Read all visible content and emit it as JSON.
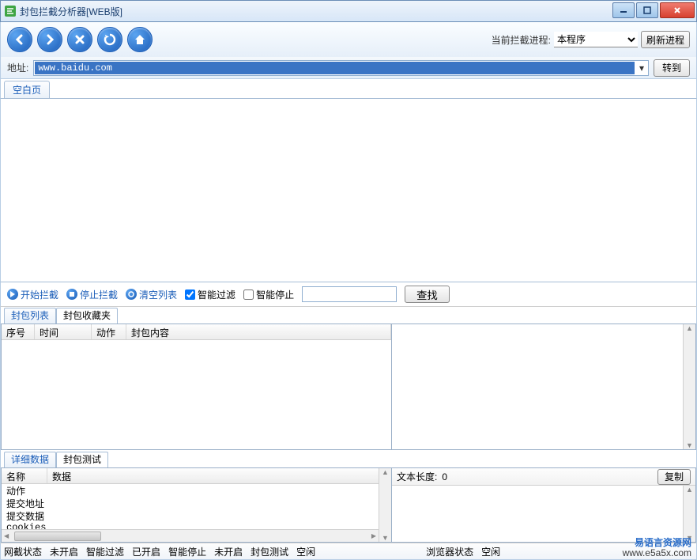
{
  "window": {
    "title": "封包拦截分析器[WEB版]"
  },
  "toolbar": {
    "process_label": "当前拦截进程:",
    "process_selected": "本程序",
    "refresh": "刷新进程"
  },
  "address": {
    "label": "地址:",
    "value": "www.baidu.com",
    "go": "转到"
  },
  "browser_tabs": [
    "空白页"
  ],
  "actions": {
    "start": "开始拦截",
    "stop": "停止拦截",
    "clear": "清空列表",
    "smart_filter": "智能过滤",
    "smart_stop": "智能停止",
    "search": "查找"
  },
  "action_checks": {
    "smart_filter": true,
    "smart_stop": false
  },
  "packet_tabs": [
    "封包列表",
    "封包收藏夹"
  ],
  "packet_columns": {
    "seq": "序号",
    "time": "时间",
    "action": "动作",
    "content": "封包内容"
  },
  "detail_tabs": [
    "详细数据",
    "封包测试"
  ],
  "detail_columns": {
    "name": "名称",
    "data": "数据"
  },
  "detail_rows": [
    "动作",
    "提交地址",
    "提交数据",
    "cookies"
  ],
  "detail_right": {
    "len_label": "文本长度:",
    "len_value": "0",
    "copy": "复制"
  },
  "status": {
    "net_label": "网截状态",
    "net_open": "未开启",
    "filter_label": "智能过滤",
    "filter_val": "已开启",
    "stop_label": "智能停止",
    "stop_val": "未开启",
    "test_label": "封包测试",
    "test_val": "空闲",
    "browser_label": "浏览器状态",
    "browser_val": "空闲"
  },
  "watermark": {
    "cn": "易语言资源网",
    "url": "www.e5a5x.com"
  }
}
